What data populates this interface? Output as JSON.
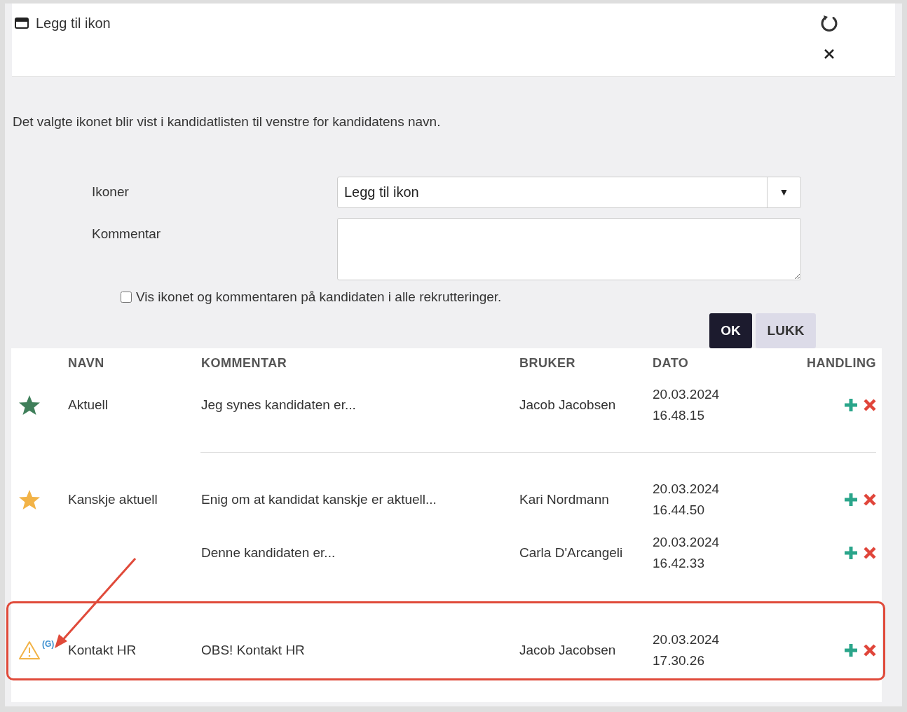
{
  "window": {
    "title": "Legg til ikon"
  },
  "description": "Det valgte ikonet blir vist i kandidatlisten til venstre for kandidatens navn.",
  "form": {
    "icon_label": "Ikoner",
    "icon_value": "Legg til ikon",
    "dropdown_arrow": "▼",
    "comment_label": "Kommentar",
    "show_everywhere": {
      "label": "Vis ikonet og kommentaren på kandidaten i alle rekrutteringer.",
      "checked": false
    }
  },
  "buttons": [
    {
      "label": "OK",
      "kind": "primary"
    },
    {
      "label": "LUKK",
      "kind": "secondary"
    }
  ],
  "table": {
    "columns": [
      "NAVN",
      "KOMMENTAR",
      "BRUKER",
      "DATO",
      "HANDLING"
    ],
    "groups": [
      {
        "kind": "star",
        "color": "#3f7f5a",
        "name": "Aktuell",
        "highlighted": false,
        "entries": [
          {
            "comment": "Jeg synes kandidaten er...",
            "user": "Jacob Jacobsen",
            "date": "20.03.2024",
            "time": "16.48.15"
          }
        ]
      },
      {
        "kind": "star",
        "color": "#f2b347",
        "name": "Kanskje aktuell",
        "highlighted": false,
        "entries": [
          {
            "comment": "Enig om at kandidat kanskje er aktuell...",
            "user": "Kari Nordmann",
            "date": "20.03.2024",
            "time": "16.44.50"
          },
          {
            "comment": "Denne kandidaten er...",
            "user": "Carla D'Arcangeli",
            "date": "20.03.2024",
            "time": "16.42.33"
          }
        ]
      },
      {
        "kind": "warning",
        "color": "#f2b347",
        "badge": "(G)",
        "name": "Kontakt HR",
        "highlighted": true,
        "entries": [
          {
            "comment": "OBS! Kontakt HR",
            "user": "Jacob Jacobsen",
            "date": "20.03.2024",
            "time": "17.30.26"
          }
        ]
      }
    ]
  }
}
